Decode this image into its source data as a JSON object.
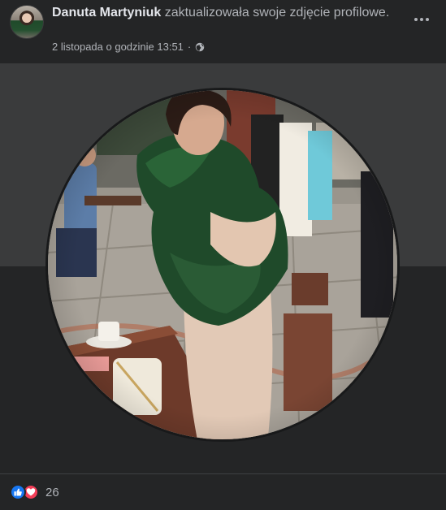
{
  "post": {
    "author": "Danuta Martyniuk",
    "action": " zaktualizowała swoje zdjęcie profilowe.",
    "timestamp": "2 listopada o godzinie 13:51",
    "separator": "·",
    "privacy_icon": "globe-icon",
    "more_icon": "more-options-icon"
  },
  "reactions": {
    "types": [
      "like-icon",
      "love-icon"
    ],
    "count": "26",
    "colors": {
      "like": "#1877f2",
      "love": "#f33e58"
    }
  },
  "colors": {
    "background": "#242526",
    "photo_band": "#3a3b3c",
    "text_primary": "#e4e6eb",
    "text_secondary": "#b0b3b8"
  }
}
